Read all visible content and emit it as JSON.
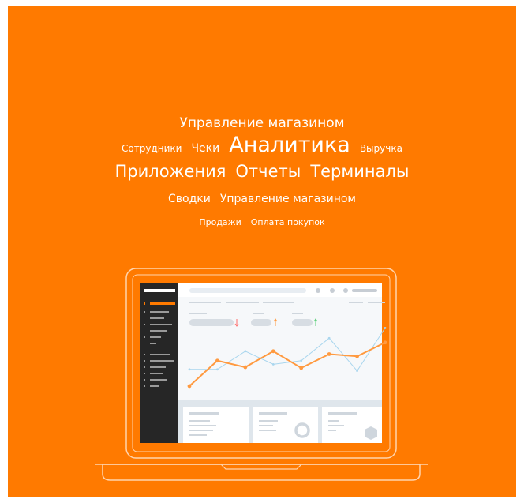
{
  "tag_cloud": {
    "row1": [
      "Управление магазином"
    ],
    "row2": [
      "Сотрудники",
      "Чеки",
      "Аналитика",
      "Выручка"
    ],
    "row3": [
      "Приложения",
      "Отчеты",
      "Терминалы"
    ],
    "row4": [
      "Сводки",
      "Управление магазином"
    ],
    "row5": [
      "Продажи",
      "Оплата покупок"
    ]
  },
  "colors": {
    "background": "#ff7a00",
    "sidebar": "#262626",
    "sidebar_active": "#ff7a00",
    "series_orange": "#ff9a40",
    "series_blue": "#a9d6ee",
    "trend_down": "#ff6b6b",
    "trend_up_orange": "#ff9a40",
    "trend_up_green": "#5ccf7a"
  },
  "illustration": {
    "icon": "laptop-dashboard-icon",
    "series_orange_values": [
      0.12,
      0.47,
      0.38,
      0.6,
      0.37,
      0.56,
      0.53,
      0.72
    ],
    "series_blue_values": [
      0.35,
      0.35,
      0.6,
      0.42,
      0.47,
      0.78,
      0.33,
      0.92
    ]
  }
}
